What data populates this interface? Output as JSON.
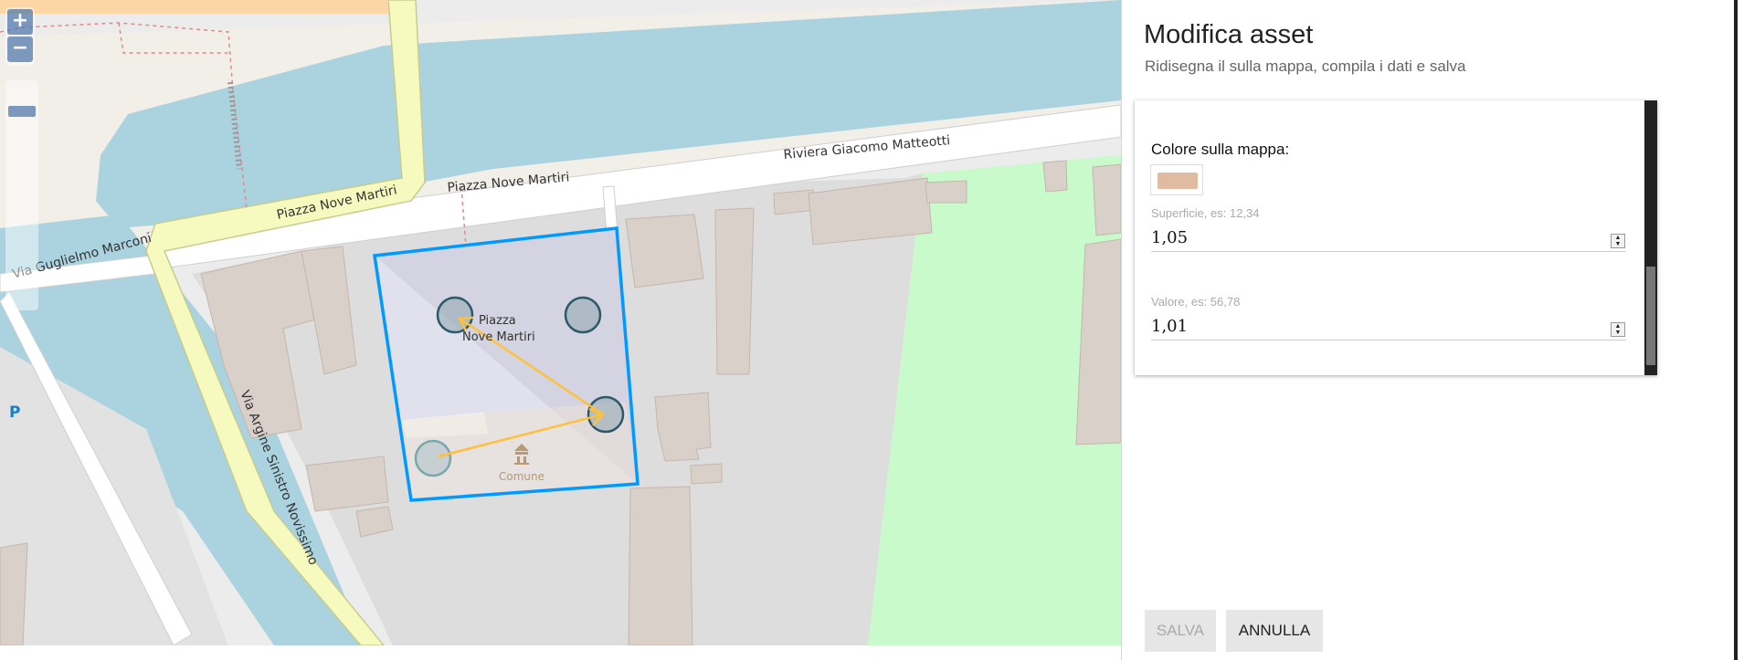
{
  "map": {
    "zoom_in_label": "+",
    "zoom_out_label": "−",
    "labels": {
      "piazza_main": "Piazza Nove Martiri",
      "piazza_street": "Piazza Nove Martiri",
      "riviera": "Riviera Giacomo Matteotti",
      "marconi": "Via Guglielmo Marconi",
      "argine": "Via Argine Sinistro Novissimo",
      "piazza_l1": "Piazza",
      "piazza_l2": "Nove Martiri",
      "comune": "Comune",
      "parking": "P"
    },
    "colors": {
      "water": "#aad3df",
      "road_primary": "#f7fabf",
      "road_primary_edge": "#c7cc8f",
      "building": "#d9d0c9",
      "building_edge": "#c4b6ab",
      "park": "#c8facc",
      "selection": "#0099ff",
      "arrow": "#ffc03a"
    }
  },
  "panel": {
    "title": "Modifica asset",
    "subtitle": "Ridisegna il sulla mappa, compila i dati e salva",
    "color_label": "Colore sulla mappa:",
    "swatch_color": "#e0bba2",
    "fields": {
      "superficie": {
        "label": "Superficie, es: 12,34",
        "value": "1,05"
      },
      "valore": {
        "label": "Valore, es: 56,78",
        "value": "1,01"
      }
    },
    "buttons": {
      "save": "SALVA",
      "cancel": "ANNULLA"
    }
  }
}
